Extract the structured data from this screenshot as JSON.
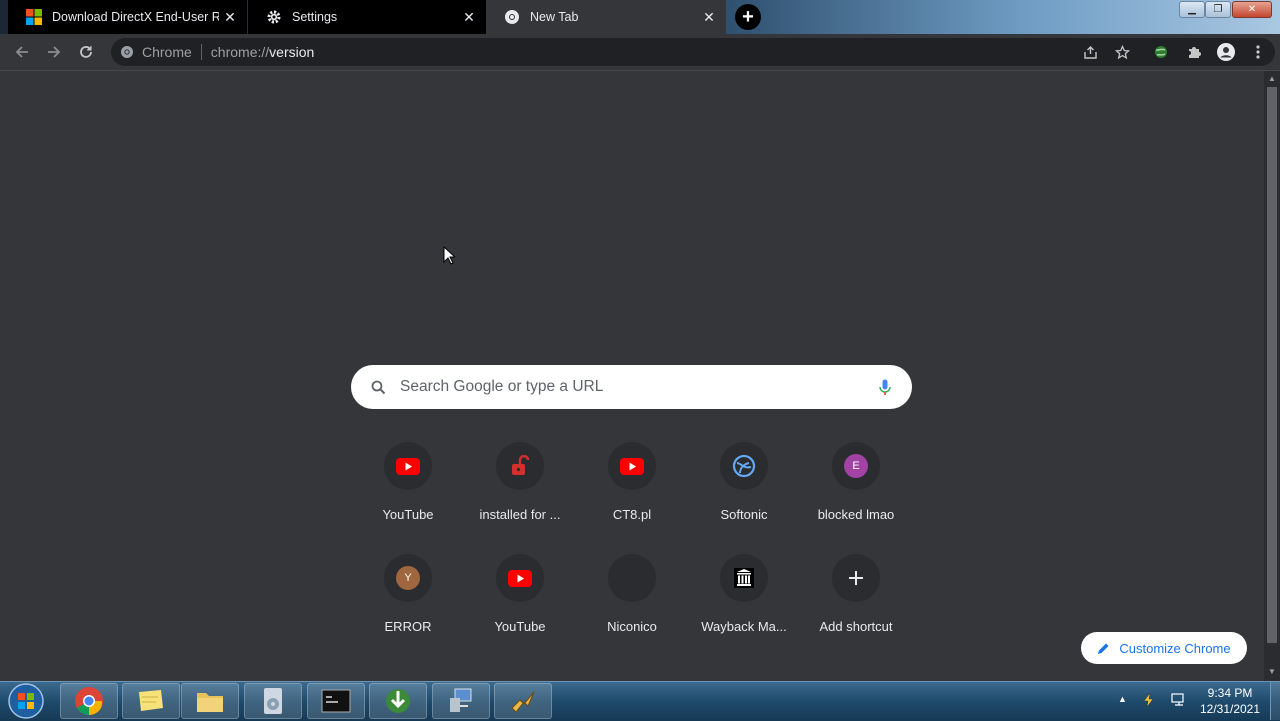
{
  "tabs": [
    {
      "label": "Download DirectX End-User Runtime",
      "icon": "windows-logo-icon"
    },
    {
      "label": "Settings",
      "icon": "gear-icon"
    },
    {
      "label": "New Tab",
      "icon": "chrome-icon"
    }
  ],
  "tab_close_glyph": "✕",
  "new_tab_glyph": "+",
  "omnibox": {
    "site": "Chrome",
    "scheme": "chrome://",
    "path": "version"
  },
  "search": {
    "placeholder": "Search Google or type a URL"
  },
  "shortcuts": [
    {
      "title": "YouTube",
      "icon": "youtube-icon"
    },
    {
      "title": "installed for ...",
      "icon": "red-lock-icon"
    },
    {
      "title": "CT8.pl",
      "icon": "youtube-icon"
    },
    {
      "title": "Softonic",
      "icon": "softonic-icon"
    },
    {
      "title": "blocked lmao",
      "icon": "letter-e-icon",
      "letter": "E",
      "color": "#a142a4"
    },
    {
      "title": "ERROR",
      "icon": "letter-y-icon",
      "letter": "Y",
      "color": "#a0663f"
    },
    {
      "title": "YouTube",
      "icon": "youtube-icon"
    },
    {
      "title": "Niconico",
      "icon": "blank-icon"
    },
    {
      "title": "Wayback Ma...",
      "icon": "wayback-icon"
    },
    {
      "title": "Add shortcut",
      "icon": "plus-icon"
    }
  ],
  "customize": {
    "label": "Customize Chrome"
  },
  "clock": {
    "time": "9:34 PM",
    "date": "12/31/2021"
  },
  "colors": {
    "page_bg": "#35363a",
    "tab_strip_dark": "#000000",
    "accent_blue": "#1a73e8",
    "youtube_red": "#ff0000"
  }
}
